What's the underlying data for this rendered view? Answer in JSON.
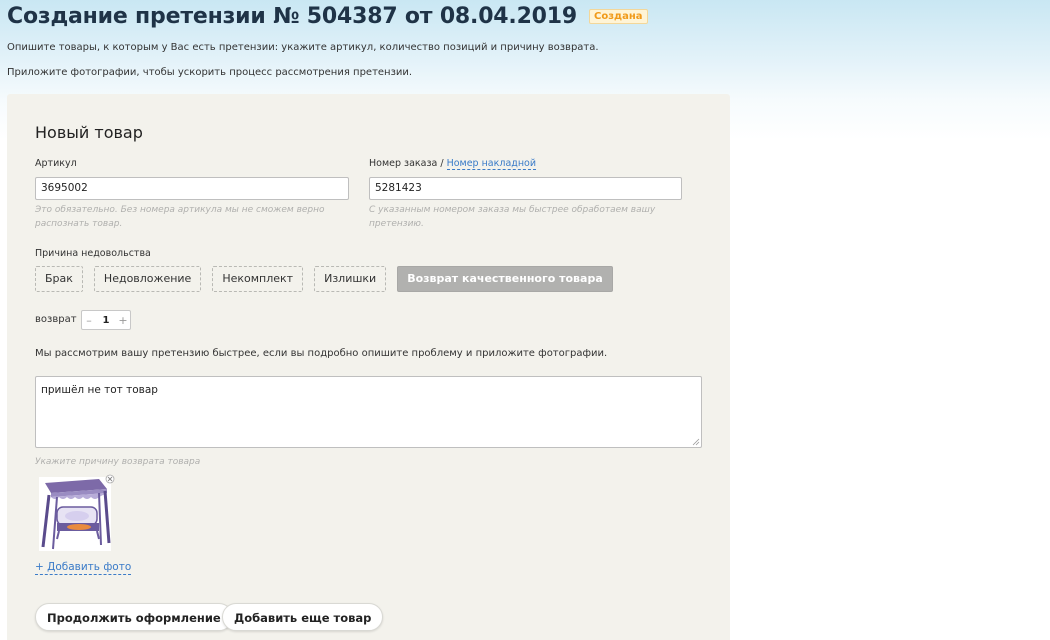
{
  "header": {
    "title": "Создание претензии № 504387 от 08.04.2019",
    "status_badge": "Создана",
    "intro_line1": "Опишите товары, к которым у Вас есть претензии: укажите артикул, количество позиций и причину возврата.",
    "intro_line2": "Приложите фотографии, чтобы ускорить процесс рассмотрения претензии."
  },
  "form": {
    "section_title": "Новый товар",
    "article": {
      "label": "Артикул",
      "value": "3695002",
      "hint_line1": "Это обязательно. Без номера артикула мы не сможем верно",
      "hint_line2": "распознать товар."
    },
    "order": {
      "label": "Номер заказа /",
      "alt_link": "Номер накладной",
      "value": "5281423",
      "hint_line1": "С указанным номером заказа мы быстрее обработаем вашу",
      "hint_line2": "претензию."
    },
    "reason": {
      "label": "Причина недовольства",
      "options": [
        "Брак",
        "Недовложение",
        "Некомплект",
        "Излишки",
        "Возврат качественного товара"
      ],
      "selected_index": 4
    },
    "quantity": {
      "label": "возврат",
      "minus": "–",
      "value": "1",
      "plus": "+"
    },
    "description_note": "Мы рассмотрим вашу претензию быстрее, если вы подробно опишите проблему и приложите фотографии.",
    "description_value": "пришёл не тот товар",
    "description_hint": "Укажите причину возврата товара",
    "add_photo_label": "+ Добавить фото"
  },
  "actions": {
    "continue_label": "Продолжить оформление",
    "add_more_label": "Добавить еще товар"
  },
  "colors": {
    "title": "#1f3347",
    "link": "#3a7bc8",
    "badge_text": "#f09a1a",
    "panel_bg": "#f3f2ec",
    "active_reason_bg": "#b1b1af"
  },
  "icons": {
    "photo_thumbnail": "garden-swing-image",
    "remove_photo": "close-circle-icon",
    "textarea_resize": "resize-grip-icon"
  }
}
